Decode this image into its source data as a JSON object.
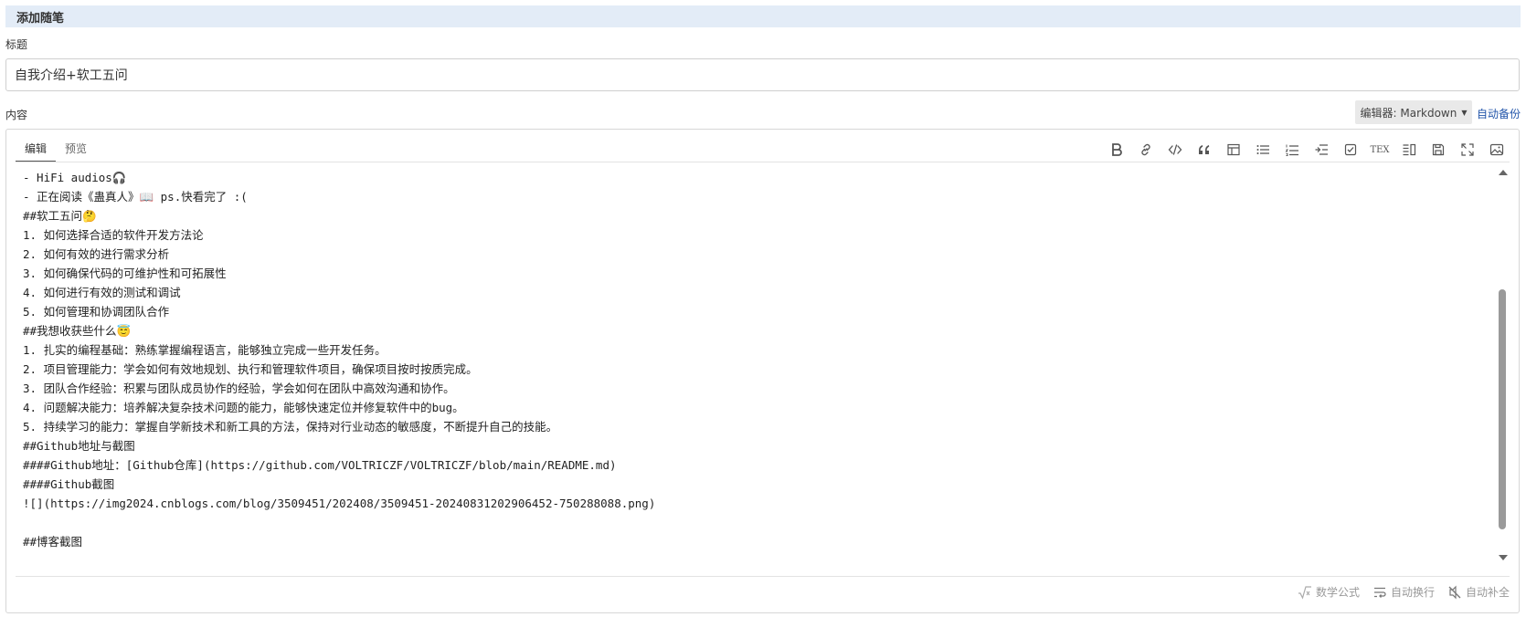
{
  "section": {
    "title": "添加随笔"
  },
  "title_field": {
    "label": "标题",
    "value": "自我介绍+软工五问"
  },
  "content_field": {
    "label": "内容"
  },
  "editor_select": {
    "label": "编辑器: Markdown"
  },
  "autosave": {
    "label": "自动备份"
  },
  "tabs": [
    {
      "label": "编辑",
      "active": true
    },
    {
      "label": "预览",
      "active": false
    }
  ],
  "toolbar": [
    {
      "icon": "bold-icon"
    },
    {
      "icon": "link-icon"
    },
    {
      "icon": "code-icon"
    },
    {
      "icon": "quote-icon"
    },
    {
      "icon": "table-icon"
    },
    {
      "icon": "bullet-list-icon"
    },
    {
      "icon": "numbered-list-icon"
    },
    {
      "icon": "indent-icon"
    },
    {
      "icon": "checkbox-icon"
    },
    {
      "icon": "tex-icon",
      "text": "TEX"
    },
    {
      "icon": "split-view-icon"
    },
    {
      "icon": "save-icon"
    },
    {
      "icon": "fullscreen-icon"
    },
    {
      "icon": "image-icon"
    }
  ],
  "content": {
    "lines": [
      "- HiFi audios🎧",
      "- 正在阅读《蛊真人》📖 ps.快看完了 :(",
      "##软工五问🤔",
      "1. 如何选择合适的软件开发方法论",
      "2. 如何有效的进行需求分析",
      "3. 如何确保代码的可维护性和可拓展性",
      "4. 如何进行有效的测试和调试",
      "5. 如何管理和协调团队合作",
      "##我想收获些什么😇",
      "1. 扎实的编程基础：熟练掌握编程语言，能够独立完成一些开发任务。",
      "2. 项目管理能力：学会如何有效地规划、执行和管理软件项目，确保项目按时按质完成。",
      "3. 团队合作经验：积累与团队成员协作的经验，学会如何在团队中高效沟通和协作。",
      "4. 问题解决能力：培养解决复杂技术问题的能力，能够快速定位并修复软件中的bug。",
      "5. 持续学习的能力：掌握自学新技术和新工具的方法，保持对行业动态的敏感度，不断提升自己的技能。",
      "##Github地址与截图",
      "####Github地址：[Github仓库](https://github.com/VOLTRICZF/VOLTRICZF/blob/main/README.md)",
      "####Github截图",
      "![](https://img2024.cnblogs.com/blog/3509451/202408/3509451-20240831202906452-750288088.png)",
      "",
      "##博客截图"
    ]
  },
  "footer": {
    "math_label": "数学公式",
    "wrap_label": "自动换行",
    "complete_label": "自动补全"
  }
}
